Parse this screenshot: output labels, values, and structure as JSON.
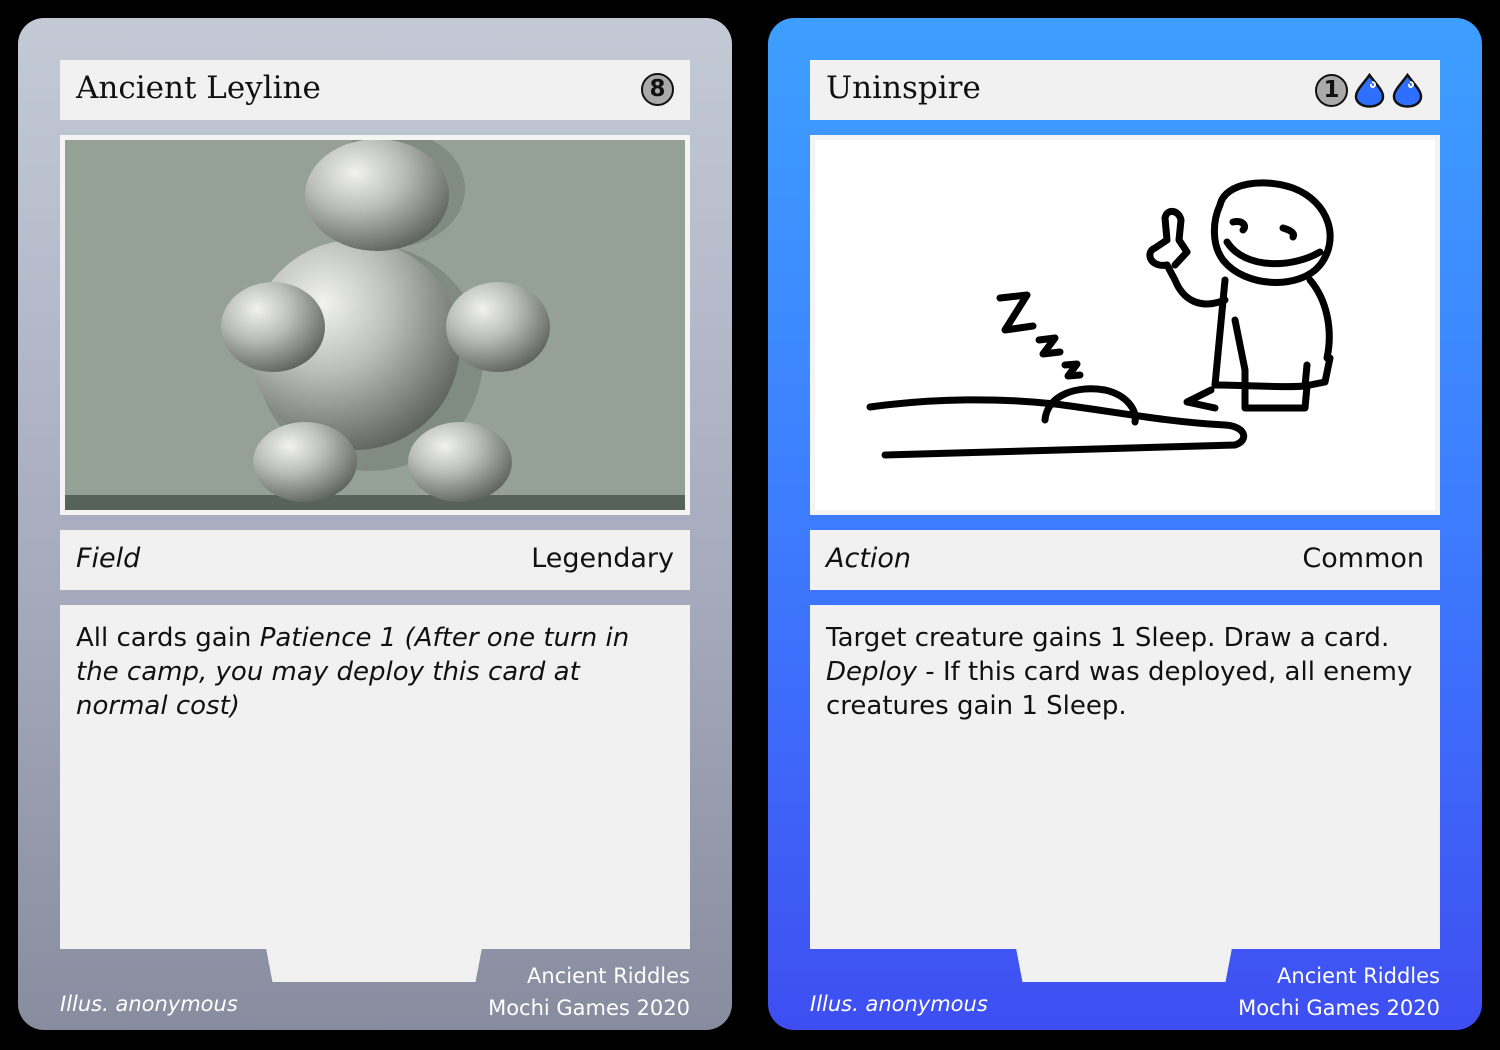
{
  "cards": [
    {
      "title": "Ancient Leyline",
      "cost": "8",
      "art_description": "grey 3D blob creature",
      "type": "Field",
      "rarity": "Legendary",
      "rules_plain": "All cards gain ",
      "rules_italic": "Patience 1 (After one turn in the camp, you may deploy this card at normal cost)",
      "illustrator": "Illus. anonymous",
      "set_name": "Ancient Riddles",
      "publisher": "Mochi Games 2020",
      "frame_color": "#a6abbd"
    },
    {
      "title": "Uninspire",
      "cost": "1",
      "cost_icons": [
        "water-drop-icon",
        "water-drop-icon"
      ],
      "type": "Action",
      "rarity": "Common",
      "rules_line1": "Target creature gains 1 Sleep. Draw a card.",
      "rules_keyword": "Deploy",
      "rules_line2": " - If this card was deployed, all enemy creatures gain 1 Sleep.",
      "illustrator": "Illus. anonymous",
      "set_name": "Ancient Riddles",
      "publisher": "Mochi Games 2020",
      "frame_color": "#3d7cff",
      "drop_color": "#2f6fff"
    }
  ]
}
